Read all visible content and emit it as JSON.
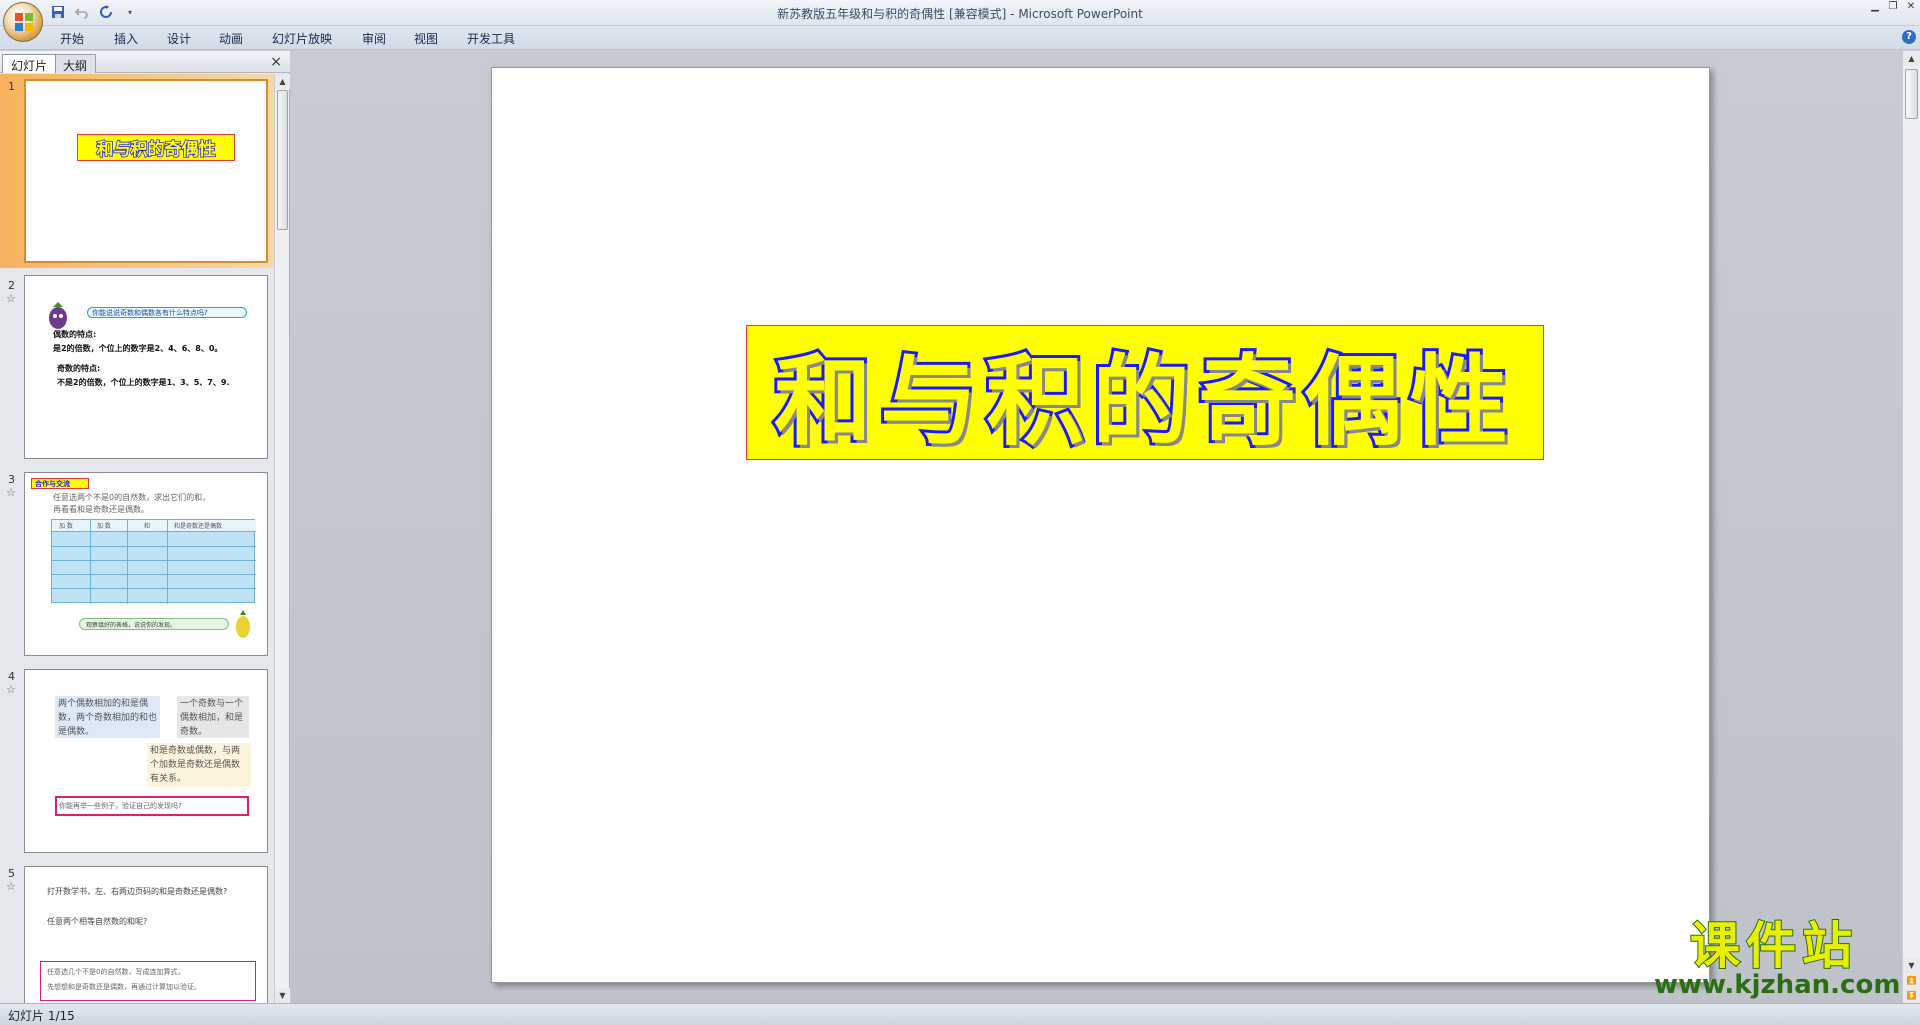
{
  "window": {
    "document_title": "新苏教版五年级和与积的奇偶性 [兼容模式]",
    "separator": " - ",
    "app_name": "Microsoft PowerPoint"
  },
  "quick_access": [
    "save-icon",
    "undo-icon",
    "redo-icon",
    "customize-icon"
  ],
  "ribbon_tabs": [
    "开始",
    "插入",
    "设计",
    "动画",
    "幻灯片放映",
    "审阅",
    "视图",
    "开发工具"
  ],
  "pane": {
    "tabs": [
      "幻灯片",
      "大纲"
    ],
    "close": "×"
  },
  "thumbnails": [
    {
      "number": "1",
      "title": "和与积的奇偶性"
    },
    {
      "number": "2",
      "bubble": "你能说说奇数和偶数各有什么特点吗?",
      "even_heading": "偶数的特点:",
      "even_text": "是2的倍数，个位上的数字是2、4、6、8、0。",
      "odd_heading": "奇数的特点:",
      "odd_text": "不是2的倍数，个位上的数字是1、3、5、7、9."
    },
    {
      "number": "3",
      "label": "合作与交流",
      "line1": "任意选两个不是0的自然数，求出它们的和，",
      "line2": "再看看和是奇数还是偶数。",
      "headers": [
        "加 数",
        "加 数",
        "和",
        "和是奇数还是偶数"
      ],
      "bubble": "观察填好的表格，说说你的发现。"
    },
    {
      "number": "4",
      "box1": "两个偶数相加的和是偶数，两个奇数相加的和也是偶数。",
      "box2": "一个奇数与一个偶数相加，和是奇数。",
      "box3": "和是奇数或偶数，与两个加数是奇数还是偶数有关系。",
      "box4": "你能再举一些例子，验证自己的发现吗?"
    },
    {
      "number": "5",
      "line1": "打开数学书，左、右两边页码的和是奇数还是偶数?",
      "line2": "任意两个相等自然数的和呢?",
      "box_line1": "任意选几个不是0的自然数，写成连加算式，",
      "box_line2": "先想想和是奇数还是偶数，再通过计算加以验证。"
    }
  ],
  "slide": {
    "title": "和与积的奇偶性"
  },
  "status": {
    "slide_indicator": "幻灯片 1/15"
  },
  "watermark": {
    "chinese": "课件站",
    "url": "www.kjzhan.com"
  },
  "colors": {
    "title_fill": "#ffff00",
    "title_outline": "#1a1aff",
    "selection": "#f7b25e"
  }
}
